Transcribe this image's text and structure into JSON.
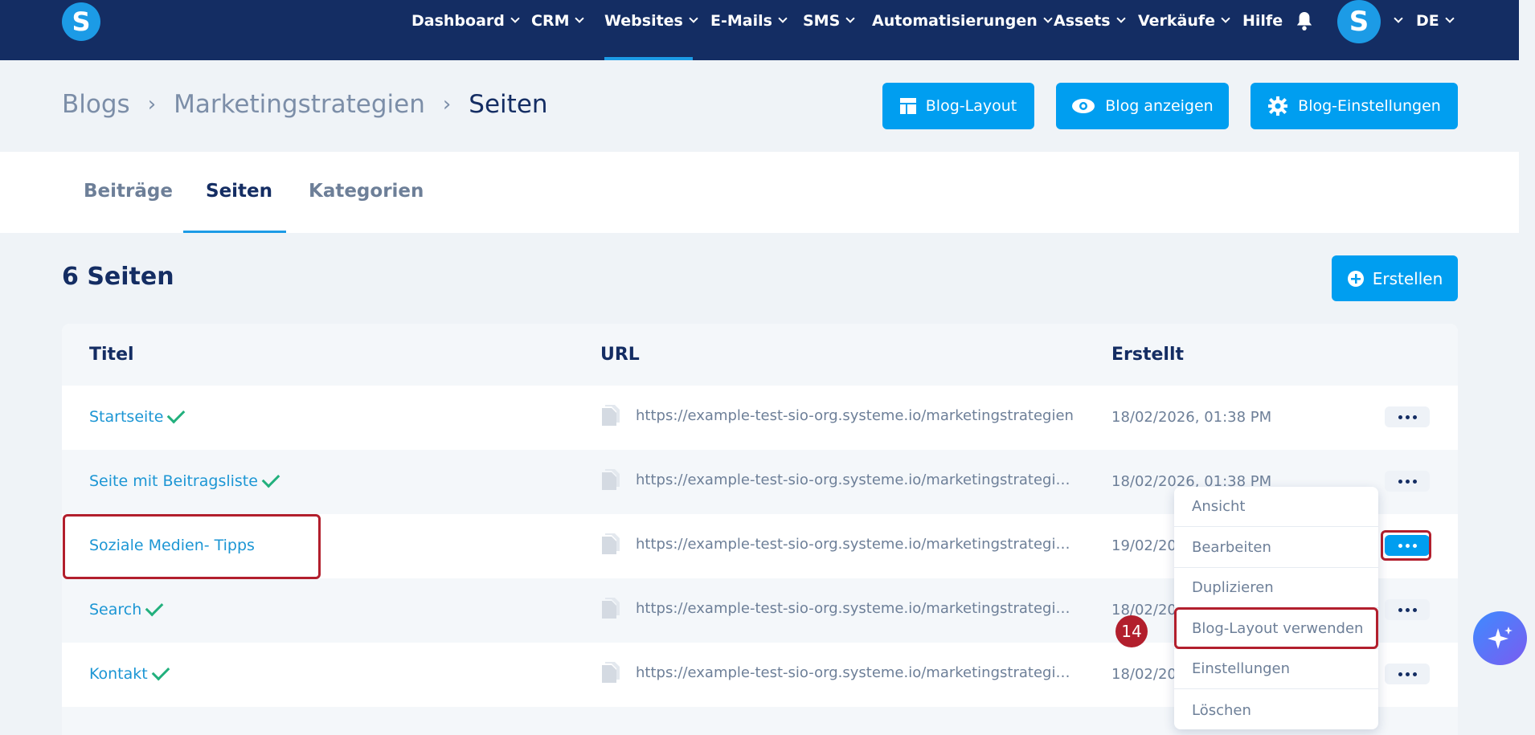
{
  "app": {
    "logo_letter": "S",
    "avatar_letter": "S",
    "language": "DE"
  },
  "nav": {
    "items": [
      {
        "label": "Dashboard",
        "dropdown": true
      },
      {
        "label": "CRM",
        "dropdown": true
      },
      {
        "label": "Websites",
        "dropdown": true,
        "active": true
      },
      {
        "label": "E-Mails",
        "dropdown": true
      },
      {
        "label": "SMS",
        "dropdown": true
      },
      {
        "label": "Automatisierungen",
        "dropdown": true
      },
      {
        "label": "Assets",
        "dropdown": true
      },
      {
        "label": "Verkäufe",
        "dropdown": true
      },
      {
        "label": "Hilfe",
        "dropdown": false
      }
    ],
    "icons": {
      "bell": "bell-icon"
    }
  },
  "breadcrumb": {
    "items": [
      "Blogs",
      "Marketingstrategien",
      "Seiten"
    ]
  },
  "header_buttons": {
    "blog_layout": "Blog-Layout",
    "blog_view": "Blog anzeigen",
    "blog_settings": "Blog-Einstellungen"
  },
  "tabs": {
    "items": [
      "Beiträge",
      "Seiten",
      "Kategorien"
    ],
    "active": "Seiten"
  },
  "list": {
    "count_label": "6 Seiten",
    "create_label": "Erstellen"
  },
  "table": {
    "columns": [
      "Titel",
      "URL",
      "Erstellt"
    ],
    "rows": [
      {
        "title": "Startseite",
        "url": "https://example-test-sio-org.systeme.io/marketingstrategien",
        "created": "18/02/2026, 01:38 PM",
        "published": true
      },
      {
        "title": "Seite mit Beitragsliste",
        "url": "https://example-test-sio-org.systeme.io/marketingstrategie…",
        "created": "18/02/2026, 01:38 PM",
        "published": true
      },
      {
        "title": "Soziale Medien- Tipps",
        "url": "https://example-test-sio-org.systeme.io/marketingstrategie…",
        "created": "19/02/20",
        "published": false
      },
      {
        "title": "Search",
        "url": "https://example-test-sio-org.systeme.io/marketingstrategie…",
        "created": "18/02/20",
        "published": true
      },
      {
        "title": "Kontakt",
        "url": "https://example-test-sio-org.systeme.io/marketingstrategie…",
        "created": "18/02/20",
        "published": true
      }
    ]
  },
  "dropdown": {
    "items": [
      "Ansicht",
      "Bearbeiten",
      "Duplizieren",
      "Blog-Layout verwenden",
      "Einstellungen",
      "Löschen"
    ],
    "highlighted": "Blog-Layout verwenden"
  },
  "annotation": {
    "step_number": "14"
  },
  "colors": {
    "navbar": "#142d63",
    "accent": "#009ef0",
    "link": "#1c96d4",
    "check": "#22b07d",
    "highlight": "#b21f2d"
  }
}
